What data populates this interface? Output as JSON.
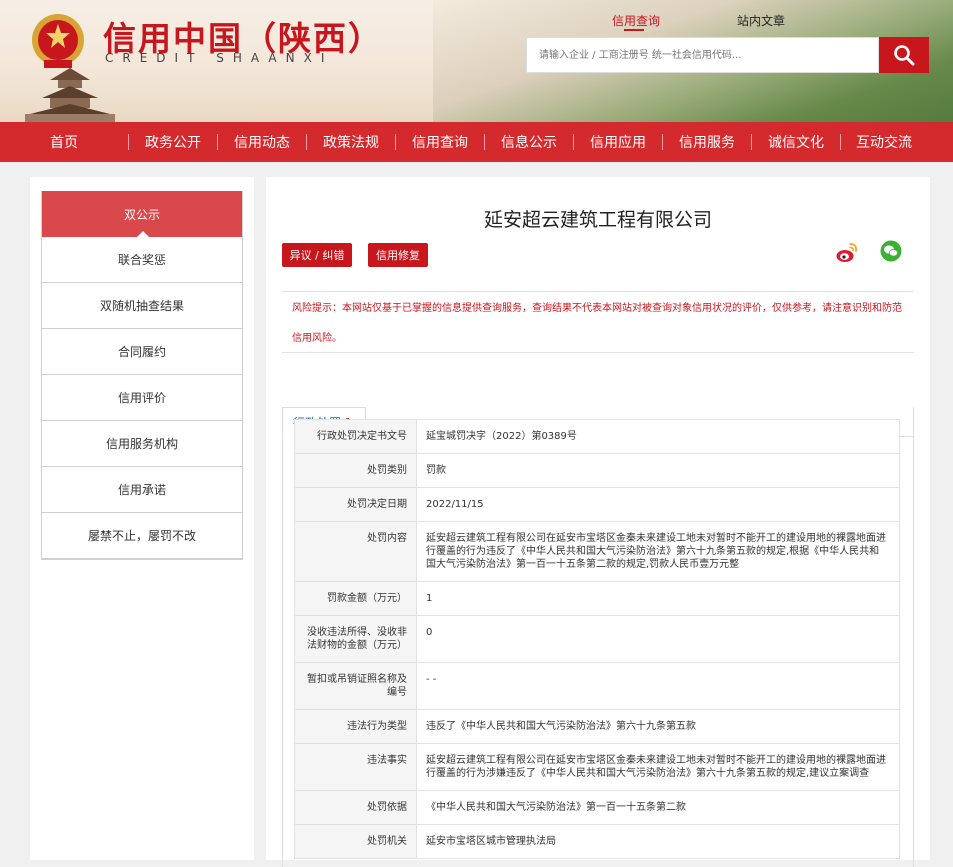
{
  "header": {
    "logo_cn": "信用中国（陕西）",
    "logo_en": "CREDIT   SHAANXI",
    "search_tabs": [
      {
        "label": "信用查询",
        "active": true
      },
      {
        "label": "站内文章",
        "active": false
      }
    ],
    "search_placeholder": "请输入企业 / 工商注册号 统一社会信用代码...",
    "search_icon": "search-icon"
  },
  "nav": [
    "首页",
    "政务公开",
    "信用动态",
    "政策法规",
    "信用查询",
    "信息公示",
    "信用应用",
    "信用服务",
    "诚信文化",
    "互动交流"
  ],
  "sidebar": [
    {
      "label": "双公示",
      "active": true
    },
    {
      "label": "联合奖惩"
    },
    {
      "label": "双随机抽查结果"
    },
    {
      "label": "合同履约"
    },
    {
      "label": "信用评价"
    },
    {
      "label": "信用服务机构"
    },
    {
      "label": "信用承诺"
    },
    {
      "label": "屡禁不止，屡罚不改"
    }
  ],
  "main": {
    "company": "延安超云建筑工程有限公司",
    "btn_objection": "异议 / 纠错",
    "btn_repair": "信用修复",
    "share_icons": [
      "weibo-icon",
      "wechat-icon"
    ],
    "risk_notice": "风险提示：本网站仅基于已掌握的信息提供查询服务，查询结果不代表本网站对被查询对象信用状况的评价，仅供参考，请注意识别和防范信用风险。",
    "tab": {
      "label": "行政处罚",
      "count": "1"
    },
    "rows": [
      {
        "k": "行政处罚决定书文号",
        "v": "延宝城罚决字（2022）第0389号"
      },
      {
        "k": "处罚类别",
        "v": "罚款"
      },
      {
        "k": "处罚决定日期",
        "v": "2022/11/15"
      },
      {
        "k": "处罚内容",
        "v": "延安超云建筑工程有限公司在延安市宝塔区金秦未来建设工地未对暂时不能开工的建设用地的裸露地面进行覆盖的行为违反了《中华人民共和国大气污染防治法》第六十九条第五款的规定,根据《中华人民共和国大气污染防治法》第一百一十五条第二款的规定,罚款人民币壹万元整"
      },
      {
        "k": "罚款金额（万元）",
        "v": "1"
      },
      {
        "k": "没收违法所得、没收非法财物的金额（万元）",
        "v": "0"
      },
      {
        "k": "暂扣或吊销证照名称及编号",
        "v": "- -"
      },
      {
        "k": "违法行为类型",
        "v": "违反了《中华人民共和国大气污染防治法》第六十九条第五款"
      },
      {
        "k": "违法事实",
        "v": "延安超云建筑工程有限公司在延安市宝塔区金秦未来建设工地未对暂时不能开工的建设用地的裸露地面进行覆盖的行为涉嫌违反了《中华人民共和国大气污染防治法》第六十九条第五款的规定,建议立案调查"
      },
      {
        "k": "处罚依据",
        "v": "《中华人民共和国大气污染防治法》第一百一十五条第二款"
      },
      {
        "k": "处罚机关",
        "v": "延安市宝塔区城市管理执法局"
      }
    ]
  }
}
